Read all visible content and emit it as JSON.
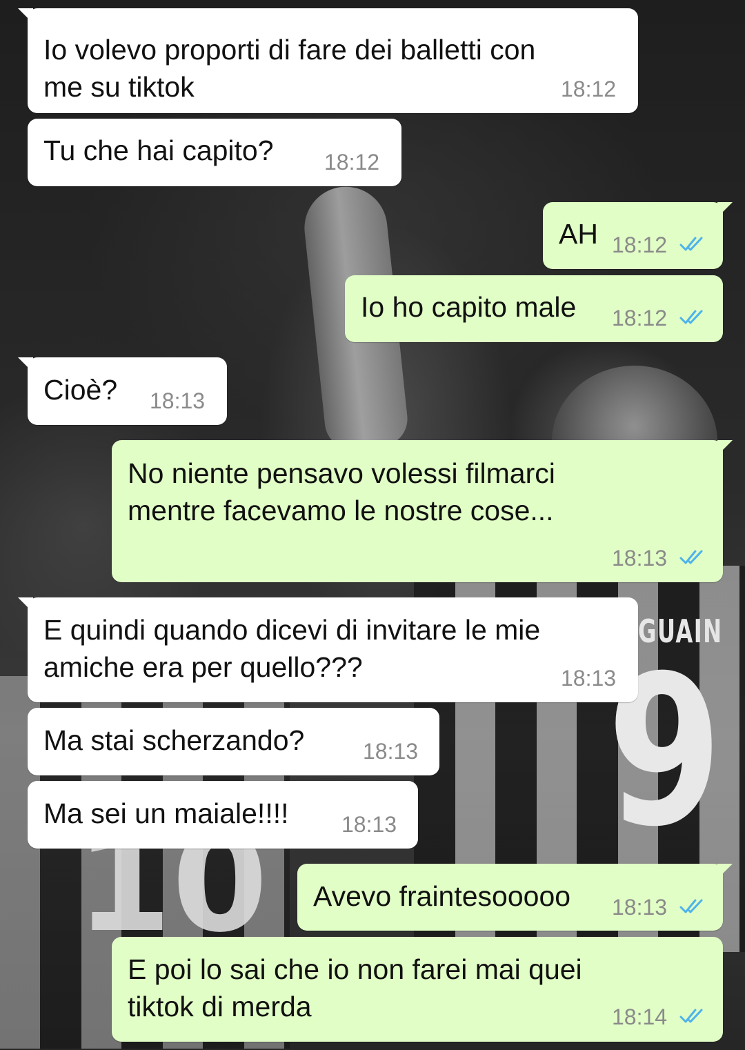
{
  "wallpaper": {
    "jersey_name": "GUAIN",
    "jersey_number": "9",
    "jersey_number_left": "10"
  },
  "colors": {
    "incoming_bubble": "#ffffff",
    "outgoing_bubble": "#e1fec6",
    "read_tick": "#4fb3ea",
    "timestamp": "#8a8a8a"
  },
  "messages": [
    {
      "direction": "incoming",
      "lines": [
        "Io volevo proporti di fare dei balletti con",
        "me su tiktok"
      ],
      "time": "18:12"
    },
    {
      "direction": "incoming",
      "lines": [
        "Tu che hai capito?"
      ],
      "time": "18:12"
    },
    {
      "direction": "outgoing",
      "lines": [
        "AH"
      ],
      "time": "18:12",
      "status_icon": "double-check-read-icon"
    },
    {
      "direction": "outgoing",
      "lines": [
        "Io ho capito male"
      ],
      "time": "18:12",
      "status_icon": "double-check-read-icon"
    },
    {
      "direction": "incoming",
      "lines": [
        "Cioè?"
      ],
      "time": "18:13"
    },
    {
      "direction": "outgoing",
      "lines": [
        "No niente pensavo volessi filmarci",
        "mentre facevamo le nostre cose..."
      ],
      "time": "18:13",
      "status_icon": "double-check-read-icon"
    },
    {
      "direction": "incoming",
      "lines": [
        "E quindi quando dicevi di invitare le mie",
        "amiche era per quello???"
      ],
      "time": "18:13"
    },
    {
      "direction": "incoming",
      "lines": [
        "Ma stai scherzando?"
      ],
      "time": "18:13"
    },
    {
      "direction": "incoming",
      "lines": [
        "Ma sei un maiale!!!!"
      ],
      "time": "18:13"
    },
    {
      "direction": "outgoing",
      "lines": [
        "Avevo fraintesooooo"
      ],
      "time": "18:13",
      "status_icon": "double-check-read-icon"
    },
    {
      "direction": "outgoing",
      "lines": [
        "E poi lo sai che io non farei mai quei",
        "tiktok di merda"
      ],
      "time": "18:14",
      "status_icon": "double-check-read-icon"
    }
  ]
}
